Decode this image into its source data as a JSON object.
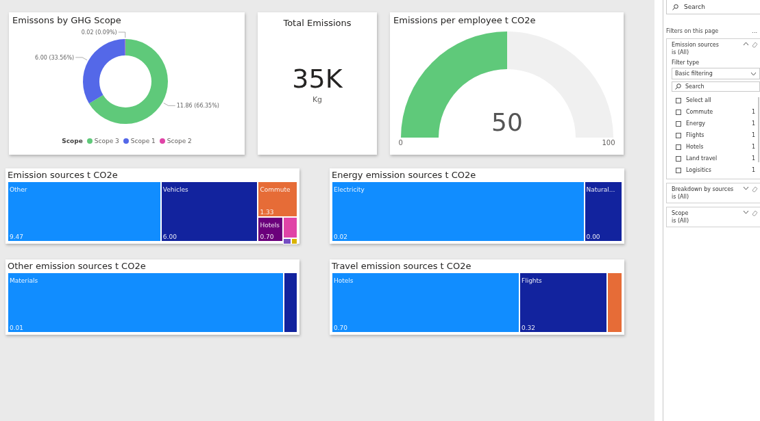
{
  "report": {
    "scope_card": {
      "chart_data": {
        "type": "donut",
        "title": "Emissons by GHG Scope",
        "categories": [
          "Scope 3",
          "Scope 1",
          "Scope 2"
        ],
        "values": [
          11.86,
          6.0,
          0.02
        ],
        "value_labels": [
          "11.86 (66.35%)",
          "6.00 (33.56%)",
          "0.02 (0.09%)"
        ]
      },
      "legend": {
        "title": "Scope",
        "items": [
          {
            "color": "#5fc97a"
          },
          {
            "color": "#5468e8"
          },
          {
            "color": "#e044a7"
          }
        ]
      }
    },
    "total_card": {
      "title": "Total Emissions",
      "value": "35K",
      "unit": "Kg"
    },
    "gauge_card": {
      "title": "Emissions per employee t CO2e",
      "value": "50",
      "min": "0",
      "max": "100",
      "level": 0.5
    },
    "treemaps": [
      {
        "title": "Emission sources t CO2e",
        "tiles": [
          {
            "label": "Other",
            "value": "9.47",
            "color": "#118dff"
          },
          {
            "label": "Vehicles",
            "value": "6.00",
            "color": "#12239e"
          },
          {
            "label": "Commute",
            "value": "1.33",
            "color": "#e66c37"
          },
          {
            "label": "Hotels",
            "value": "0.70",
            "color": "#6b007b"
          },
          {
            "color": "#e044a7"
          },
          {
            "color": "#744ec2"
          },
          {
            "color": "#d9b300"
          }
        ]
      },
      {
        "title": "Energy emission sources t CO2e",
        "tiles": [
          {
            "label": "Electricity",
            "value": "0.02",
            "color": "#118dff"
          },
          {
            "label": "Natural...",
            "value": "0.00",
            "color": "#12239e"
          }
        ]
      },
      {
        "title": "Other emission sources t CO2e",
        "tiles": [
          {
            "label": "Materials",
            "value": "0.01",
            "color": "#118dff"
          },
          {
            "color": "#12239e"
          }
        ]
      },
      {
        "title": "Travel emission sources t CO2e",
        "tiles": [
          {
            "label": "Hotels",
            "value": "0.70",
            "color": "#118dff"
          },
          {
            "label": "Flights",
            "value": "0.32",
            "color": "#12239e"
          },
          {
            "color": "#e66c37"
          }
        ]
      }
    ]
  },
  "filters_pane": {
    "search": {
      "placeholder": "Search"
    },
    "heading": "Filters on this page",
    "more": "...",
    "filters": [
      {
        "name": "Emission sources",
        "summary": "is (All)",
        "expanded": true,
        "filter_type_label": "Filter type",
        "filter_type": "Basic filtering",
        "search": {
          "placeholder": "Search"
        },
        "items": [
          {
            "label": "Select all",
            "checked": false
          },
          {
            "label": "Commute",
            "count": "1",
            "checked": false
          },
          {
            "label": "Energy",
            "count": "1",
            "checked": false
          },
          {
            "label": "Flights",
            "count": "1",
            "checked": false
          },
          {
            "label": "Hotels",
            "count": "1",
            "checked": false
          },
          {
            "label": "Land travel",
            "count": "1",
            "checked": false
          },
          {
            "label": "Logisitics",
            "count": "1",
            "checked": false
          }
        ]
      },
      {
        "name": "Breakdown by sources",
        "summary": "is (All)",
        "expanded": false
      },
      {
        "name": "Scope",
        "summary": "is (All)",
        "expanded": false
      }
    ]
  }
}
